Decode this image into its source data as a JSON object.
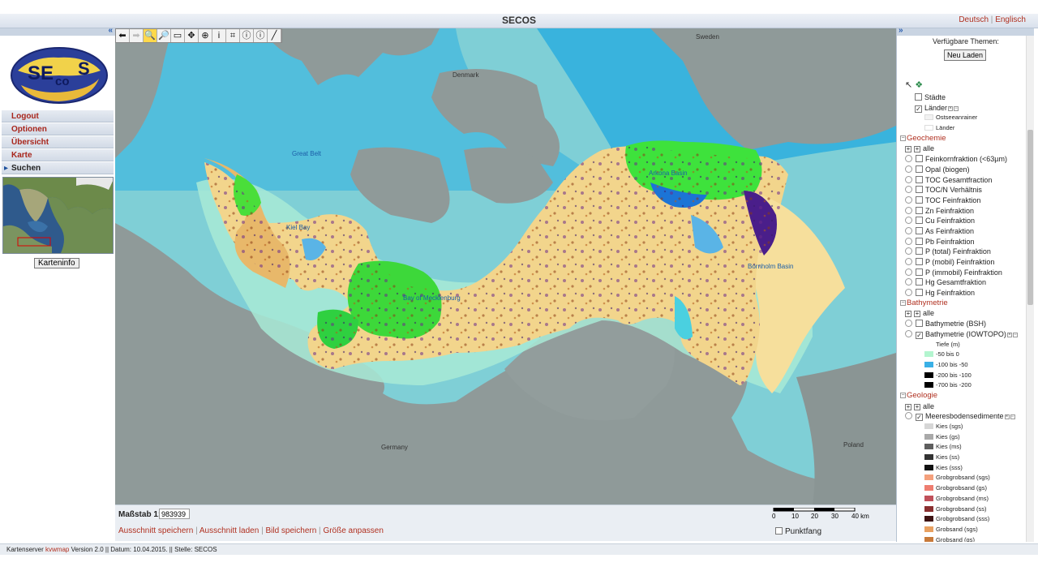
{
  "app": {
    "title": "SECOS",
    "lang_de": "Deutsch",
    "lang_sep": "|",
    "lang_en": "Englisch"
  },
  "logo": {
    "text_se": "SE",
    "text_co": "co",
    "text_s": "S"
  },
  "menu": {
    "items": [
      {
        "label": "Logout"
      },
      {
        "label": "Optionen"
      },
      {
        "label": "Übersicht"
      },
      {
        "label": "Karte"
      },
      {
        "label": "Suchen"
      }
    ],
    "karteninfo": "Karteninfo"
  },
  "map": {
    "labels": {
      "sweden": "Sweden",
      "denmark": "Denmark",
      "great_belt": "Great Belt",
      "kiel_bay": "Kiel Bay",
      "arkona_basin": "Arkona Basin",
      "bay_of_mecklenburg": "Bay of Mecklenburg",
      "bornholm_basin": "Bornholm Basin",
      "germany": "Germany",
      "poland": "Poland"
    }
  },
  "bottom": {
    "scale_label": "Maßstab 1:",
    "scale_value": "983939",
    "scalebar_ticks": [
      "0",
      "10",
      "20",
      "30",
      "40 km"
    ],
    "actions": [
      "Ausschnitt speichern",
      "Ausschnitt laden",
      "Bild speichern",
      "Größe anpassen"
    ],
    "punktfang": "Punktfang"
  },
  "status": {
    "prefix": "Kartenserver",
    "brand": "kvwmap",
    "rest": "Version 2.0 || Datum: 10.04.2015. || Stelle: SECOS"
  },
  "right": {
    "themes_label": "Verfügbare Themen:",
    "reload": "Neu Laden",
    "rows": [
      {
        "type": "layer",
        "label": "Städte",
        "checked": false,
        "indent": 1
      },
      {
        "type": "layer",
        "label": "Länder",
        "checked": true,
        "indent": 1,
        "extra": true
      },
      {
        "type": "legend",
        "label": "Ostseeanrainer",
        "color": "#f2f2f2"
      },
      {
        "type": "legend",
        "label": "Länder",
        "color": "#ffffff"
      },
      {
        "type": "group",
        "label": "Geochemie"
      },
      {
        "type": "all",
        "label": "alle"
      },
      {
        "type": "layer",
        "label": "Feinkornfraktion (<63µm)",
        "checked": false,
        "radio": true
      },
      {
        "type": "layer",
        "label": "Opal (biogen)",
        "checked": false,
        "radio": true
      },
      {
        "type": "layer",
        "label": "TOC Gesamtfraction",
        "checked": false,
        "radio": true
      },
      {
        "type": "layer",
        "label": "TOC/N Verhältnis",
        "checked": false,
        "radio": true
      },
      {
        "type": "layer",
        "label": "TOC Feinfraktion",
        "checked": false,
        "radio": true
      },
      {
        "type": "layer",
        "label": "Zn Feinfraktion",
        "checked": false,
        "radio": true
      },
      {
        "type": "layer",
        "label": "Cu Feinfraktion",
        "checked": false,
        "radio": true
      },
      {
        "type": "layer",
        "label": "As Feinfraktion",
        "checked": false,
        "radio": true
      },
      {
        "type": "layer",
        "label": "Pb Feinfraktion",
        "checked": false,
        "radio": true
      },
      {
        "type": "layer",
        "label": "P (total) Feinfraktion",
        "checked": false,
        "radio": true
      },
      {
        "type": "layer",
        "label": "P (mobil) Feinfraktion",
        "checked": false,
        "radio": true
      },
      {
        "type": "layer",
        "label": "P (immobil) Feinfraktion",
        "checked": false,
        "radio": true
      },
      {
        "type": "layer",
        "label": "Hg Gesamtfraktion",
        "checked": false,
        "radio": true
      },
      {
        "type": "layer",
        "label": "Hg Feinfraktion",
        "checked": false,
        "radio": true
      },
      {
        "type": "group",
        "label": "Bathymetrie"
      },
      {
        "type": "all",
        "label": "alle"
      },
      {
        "type": "layer",
        "label": "Bathymetrie (BSH)",
        "checked": false,
        "radio": true
      },
      {
        "type": "layer",
        "label": "Bathymetrie (IOWTOPO)",
        "checked": true,
        "radio": true,
        "extra": true
      },
      {
        "type": "legendtitle",
        "label": "Tiefe (m)"
      },
      {
        "type": "legend",
        "label": "-50 bis 0",
        "color": "#b3f5cf"
      },
      {
        "type": "legend",
        "label": "-100 bis -50",
        "color": "#3ab0e6"
      },
      {
        "type": "legend",
        "label": "-200 bis -100",
        "color": "#000000"
      },
      {
        "type": "legend",
        "label": "-700 bis -200",
        "color": "#000000"
      },
      {
        "type": "group",
        "label": "Geologie"
      },
      {
        "type": "all",
        "label": "alle"
      },
      {
        "type": "layer",
        "label": "Meeresbodensedimente",
        "checked": true,
        "radio": true,
        "extra": true
      },
      {
        "type": "legend",
        "label": "Kies (sgs)",
        "color": "#d6d6d6"
      },
      {
        "type": "legend",
        "label": "Kies (gs)",
        "color": "#a9a9a9"
      },
      {
        "type": "legend",
        "label": "Kies (ms)",
        "color": "#5e5e5e"
      },
      {
        "type": "legend",
        "label": "Kies (ss)",
        "color": "#333333"
      },
      {
        "type": "legend",
        "label": "Kies (sss)",
        "color": "#111111"
      },
      {
        "type": "legend",
        "label": "Grobgrobsand (sgs)",
        "color": "#f4a07c"
      },
      {
        "type": "legend",
        "label": "Grobgrobsand (gs)",
        "color": "#ee7d70"
      },
      {
        "type": "legend",
        "label": "Grobgrobsand (ms)",
        "color": "#c0505a"
      },
      {
        "type": "legend",
        "label": "Grobgrobsand (ss)",
        "color": "#8a2f2f"
      },
      {
        "type": "legend",
        "label": "Grobgrobsand (sss)",
        "color": "#3d1212"
      },
      {
        "type": "legend",
        "label": "Grobsand (sgs)",
        "color": "#e8a060"
      },
      {
        "type": "legend",
        "label": "Grobsand (gs)",
        "color": "#c87a3a"
      }
    ]
  }
}
